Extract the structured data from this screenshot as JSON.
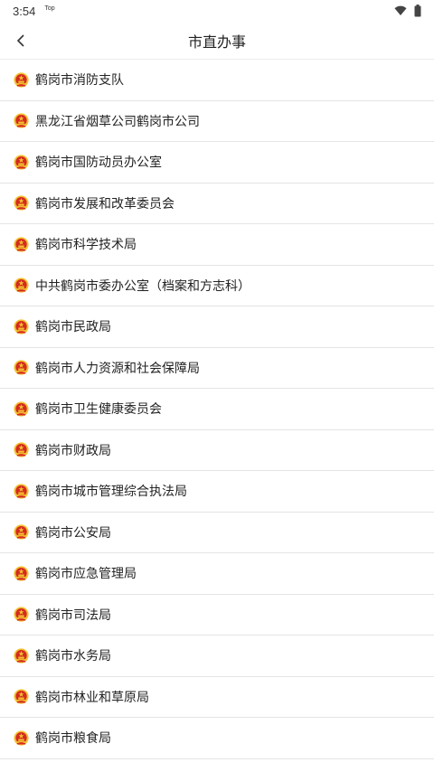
{
  "status": {
    "time": "3:54",
    "top_tag": "Top"
  },
  "header": {
    "title": "市直办事"
  },
  "colors": {
    "emblem_red": "#d42a1f",
    "emblem_gold": "#f2c230",
    "divider": "#e4e4e4"
  },
  "list": {
    "items": [
      {
        "label": "鹤岗市消防支队"
      },
      {
        "label": "黑龙江省烟草公司鹤岗市公司"
      },
      {
        "label": "鹤岗市国防动员办公室"
      },
      {
        "label": "鹤岗市发展和改革委员会"
      },
      {
        "label": "鹤岗市科学技术局"
      },
      {
        "label": "中共鹤岗市委办公室（档案和方志科）"
      },
      {
        "label": "鹤岗市民政局"
      },
      {
        "label": "鹤岗市人力资源和社会保障局"
      },
      {
        "label": "鹤岗市卫生健康委员会"
      },
      {
        "label": "鹤岗市财政局"
      },
      {
        "label": "鹤岗市城市管理综合执法局"
      },
      {
        "label": "鹤岗市公安局"
      },
      {
        "label": "鹤岗市应急管理局"
      },
      {
        "label": "鹤岗市司法局"
      },
      {
        "label": "鹤岗市水务局"
      },
      {
        "label": "鹤岗市林业和草原局"
      },
      {
        "label": "鹤岗市粮食局"
      }
    ]
  }
}
